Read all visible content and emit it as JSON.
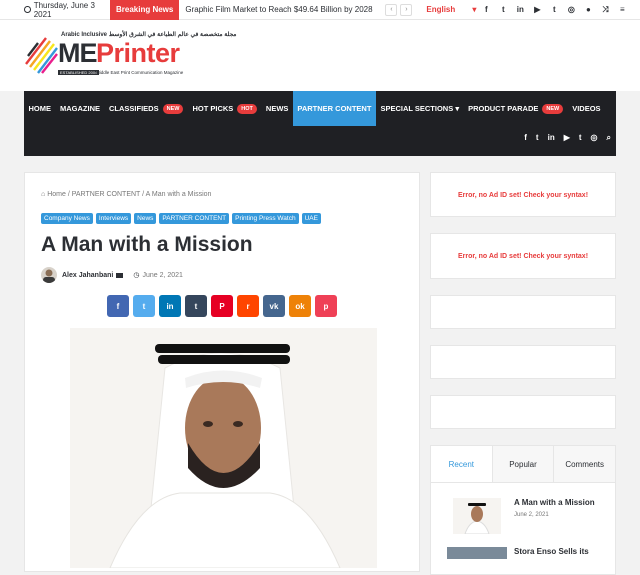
{
  "topbar": {
    "date": "Thursday, June 3 2021",
    "breaking_label": "Breaking News",
    "ticker": "Graphic Film Market to Reach $49.64 Billion by 2028",
    "prev": "‹",
    "next": "›",
    "language": "English",
    "language_caret": "▾",
    "icons": [
      "facebook-icon",
      "twitter-icon",
      "linkedin-icon",
      "youtube-icon",
      "tumblr-icon",
      "instagram-icon",
      "user-icon",
      "random-icon",
      "menu-icon"
    ]
  },
  "logo": {
    "arabic_line": "مجلة متخصصة في عالم الطباعة في الشرق الأوسط",
    "tag": "Arabic Inclusive",
    "me": "ME",
    "printer": "Printer",
    "subtitle": "Middle East Print Communication Magazine",
    "established": "ESTABLISHED 2004"
  },
  "nav": {
    "items": [
      {
        "label": "HOME"
      },
      {
        "label": "MAGAZINE"
      },
      {
        "label": "CLASSIFIEDS",
        "badge": "NEW"
      },
      {
        "label": "HOT PICKS",
        "badge": "HOT"
      },
      {
        "label": "NEWS"
      },
      {
        "label": "PARTNER CONTENT",
        "active": true
      },
      {
        "label": "SPECIAL SECTIONS ▾"
      },
      {
        "label": "PRODUCT PARADE",
        "badge": "NEW"
      },
      {
        "label": "VIDEOS"
      }
    ]
  },
  "article": {
    "breadcrumb_home": "Home",
    "breadcrumb_section": "PARTNER CONTENT",
    "breadcrumb_current": "A Man with a Mission",
    "breadcrumb_sep": "/",
    "categories": [
      "Company News",
      "Interviews",
      "News",
      "PARTNER CONTENT",
      "Printing Press Watch",
      "UAE"
    ],
    "title": "A Man with a Mission",
    "author": "Alex Jahanbani",
    "date": "June 2, 2021"
  },
  "shares": [
    {
      "name": "facebook",
      "glyph": "f",
      "color": "#4267b2"
    },
    {
      "name": "twitter",
      "glyph": "t",
      "color": "#55acee"
    },
    {
      "name": "linkedin",
      "glyph": "in",
      "color": "#0077b5"
    },
    {
      "name": "tumblr",
      "glyph": "t",
      "color": "#35465c"
    },
    {
      "name": "pinterest",
      "glyph": "P",
      "color": "#e60023"
    },
    {
      "name": "reddit",
      "glyph": "r",
      "color": "#ff4500"
    },
    {
      "name": "vk",
      "glyph": "vk",
      "color": "#45668e"
    },
    {
      "name": "odnoklassniki",
      "glyph": "ok",
      "color": "#ee8208"
    },
    {
      "name": "pocket",
      "glyph": "p",
      "color": "#ef4056"
    }
  ],
  "sidebar": {
    "ad_error_1": "Error, no Ad ID set! Check your syntax!",
    "ad_error_2": "Error, no Ad ID set! Check your syntax!",
    "tabs": [
      "Recent",
      "Popular",
      "Comments"
    ],
    "recent_title": "A Man with a Mission",
    "recent_date": "June 2, 2021",
    "recent2_title": "Stora Enso Sells its"
  }
}
